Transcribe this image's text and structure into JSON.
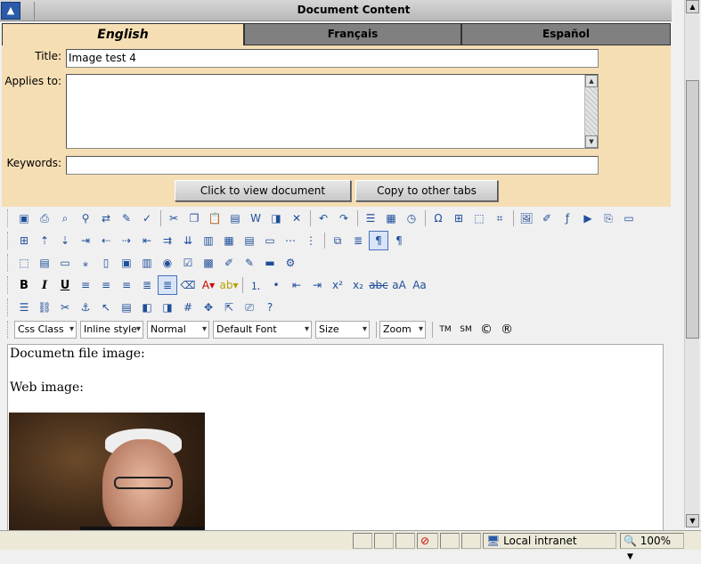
{
  "window": {
    "title": "Document Content",
    "collapse_icon": "collapse-up-icon"
  },
  "tabs": [
    {
      "label": "English",
      "active": true
    },
    {
      "label": "Français",
      "active": false
    },
    {
      "label": "Español",
      "active": false
    }
  ],
  "form": {
    "title_label": "Title:",
    "title_value": "Image test 4",
    "applies_label": "Applies to:",
    "applies_value": "",
    "keywords_label": "Keywords:",
    "keywords_value": "",
    "view_button": "Click to view document",
    "copy_button": "Copy to other tabs"
  },
  "toolbar": {
    "dropdowns": {
      "css_class": "Css Class",
      "inline_style": "Inline style",
      "paragraph": "Normal",
      "font": "Default Font",
      "size": "Size",
      "zoom": "Zoom"
    },
    "format": {
      "bold": "B",
      "italic": "I",
      "underline": "U"
    },
    "symbols": {
      "trademark": "TM",
      "servicemark": "SM",
      "copyright": "©",
      "registered": "®"
    }
  },
  "editor": {
    "line1": "Documetn file image:",
    "line2": "Web image:"
  },
  "status": {
    "zone": "Local intranet",
    "zoom": "100%"
  },
  "colors": {
    "panel": "#f5deb3",
    "inactive_tab": "#808080",
    "accent": "#2a5aa8"
  }
}
